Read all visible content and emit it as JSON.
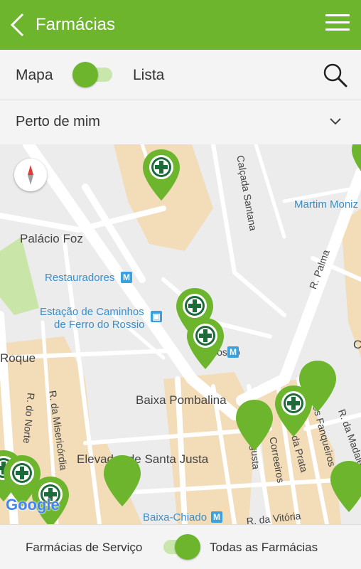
{
  "header": {
    "title": "Farmácias",
    "back_icon": "chevron-left-icon",
    "menu_icon": "hamburger-menu-icon"
  },
  "view_toggle": {
    "left_label": "Mapa",
    "right_label": "Lista",
    "selected": "Mapa"
  },
  "search": {
    "icon": "search-icon"
  },
  "filter": {
    "selected": "Perto de mim",
    "icon": "chevron-down-icon"
  },
  "map": {
    "labels": {
      "palacio_foz": "Palácio Foz",
      "restauradores": "Restauradores",
      "estacao_1": "Estação de Caminhos",
      "estacao_2": "de Ferro do Rossio",
      "roque": "Roque",
      "rossio": "Rossio",
      "baixa_pombalina": "Baixa Pombalina",
      "elevador": "Elevador de Santa Justa",
      "baixa_chiado": "Baixa-Chiado",
      "calcada_santana": "Calçada Santana",
      "martim_moniz": "Martim Moniz",
      "r_palma": "R. Palma",
      "r_do_norte": "R. do Norte",
      "r_misericordia": "R. da Misericórdia",
      "augusta": "Augusta",
      "correeiros": "Correeiros",
      "r_prata": "R. da Prata",
      "fanqueiros": "R. dos Fanqueiros",
      "r_madalena": "R. da Madalena",
      "r_vitoria": "R. da Vitória",
      "edge_c": "C"
    },
    "attribution": "Google",
    "colors": {
      "pin_green": "#6cb52d",
      "road": "#ffffff",
      "block_tan": "#f3dcb8",
      "park": "#c9e6a8",
      "transit_blue": "#3aa0de"
    }
  },
  "service_toggle": {
    "left_label": "Farmácias de Serviço",
    "right_label": "Todas as Farmácias",
    "selected": "Todas as Farmácias"
  },
  "theme": {
    "primary": "#6cb52d",
    "primary_light": "#c9e6ac"
  }
}
